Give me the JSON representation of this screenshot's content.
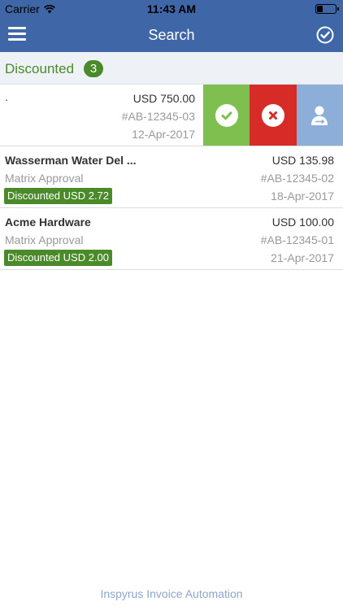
{
  "status_bar": {
    "carrier": "Carrier",
    "time": "11:43 AM"
  },
  "nav": {
    "title": "Search"
  },
  "section": {
    "label": "Discounted",
    "count": "3"
  },
  "rows": [
    {
      "vendor": ".",
      "amount": "USD 750.00",
      "invoice": "#AB-12345-03",
      "date": "12-Apr-2017"
    },
    {
      "vendor": "Wasserman Water Del ...",
      "workflow": "Matrix Approval",
      "discount": "Discounted USD 2.72",
      "amount": "USD 135.98",
      "invoice": "#AB-12345-02",
      "date": "18-Apr-2017"
    },
    {
      "vendor": "Acme Hardware",
      "workflow": "Matrix Approval",
      "discount": "Discounted USD 2.00",
      "amount": "USD 100.00",
      "invoice": "#AB-12345-01",
      "date": "21-Apr-2017"
    }
  ],
  "swipe_actions": {
    "approve_icon": "check-icon",
    "reject_icon": "x-icon",
    "reassign_icon": "reassign-user-icon",
    "colors": {
      "approve": "#7fbf4f",
      "reject": "#d62b26",
      "reassign": "#8caed8"
    }
  },
  "footer": {
    "text": "Inspyrus Invoice Automation"
  },
  "theme": {
    "nav_blue": "#3f66a6",
    "green": "#4a8a2a"
  }
}
